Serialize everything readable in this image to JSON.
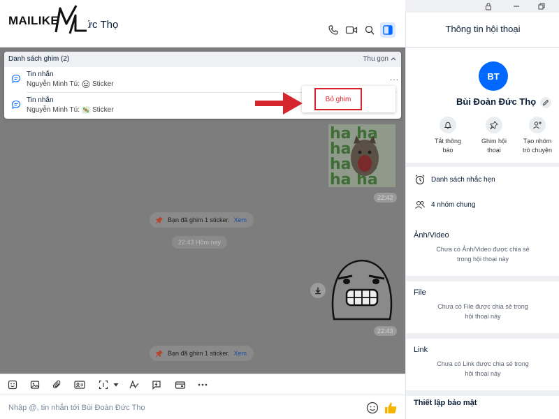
{
  "logo": {
    "text": "MAILIKE"
  },
  "chat": {
    "header_name": "ức Thọ",
    "pinned": {
      "title": "Danh sách ghim (2)",
      "collapse_label": "Thu gọn",
      "items": [
        {
          "type": "Tin nhắn",
          "sender": "Nguyễn Minh Tú:",
          "content": "Sticker"
        },
        {
          "type": "Tin nhắn",
          "sender": "Nguyễn Minh Tú:",
          "content": "Sticker"
        }
      ],
      "more_label": "...",
      "unpin_label": "Bỏ ghim"
    },
    "messages": {
      "time_1": "22:42",
      "note_1": {
        "text": "Bạn đã ghim 1 sticker.",
        "link": "Xem"
      },
      "day_chip": "22:43 Hôm nay",
      "time_2": "22:43",
      "note_2": {
        "text": "Bạn đã ghim 1 sticker.",
        "link": "Xem"
      }
    },
    "composer_placeholder": "Nhập @, tin nhắn tới Bùi Đoàn Đức Thọ"
  },
  "info": {
    "title": "Thông tin hội thoại",
    "avatar_initials": "BT",
    "name": "Bùi Đoàn Đức Thọ",
    "actions": [
      {
        "line1": "Tắt thông",
        "line2": "báo"
      },
      {
        "line1": "Ghim hội",
        "line2": "thoại"
      },
      {
        "line1": "Tạo nhóm",
        "line2": "trò chuyện"
      }
    ],
    "list": {
      "reminders": "Danh sách nhắc hẹn",
      "groups": "4 nhóm chung"
    },
    "media": {
      "title": "Ảnh/Video",
      "line1": "Chưa có Ảnh/Video được chia sẻ",
      "line2": "trong hội thoại này"
    },
    "file": {
      "title": "File",
      "line1": "Chưa có File được chia sẻ trong",
      "line2": "hội thoại này"
    },
    "link": {
      "title": "Link",
      "line1": "Chưa có Link được chia sẻ trong",
      "line2": "hội thoại này"
    },
    "security": {
      "title": "Thiết lập bảo mật"
    }
  },
  "colors": {
    "brand": "#0068ff",
    "highlight": "#d7252d",
    "overlay": "#7d7d7d"
  }
}
